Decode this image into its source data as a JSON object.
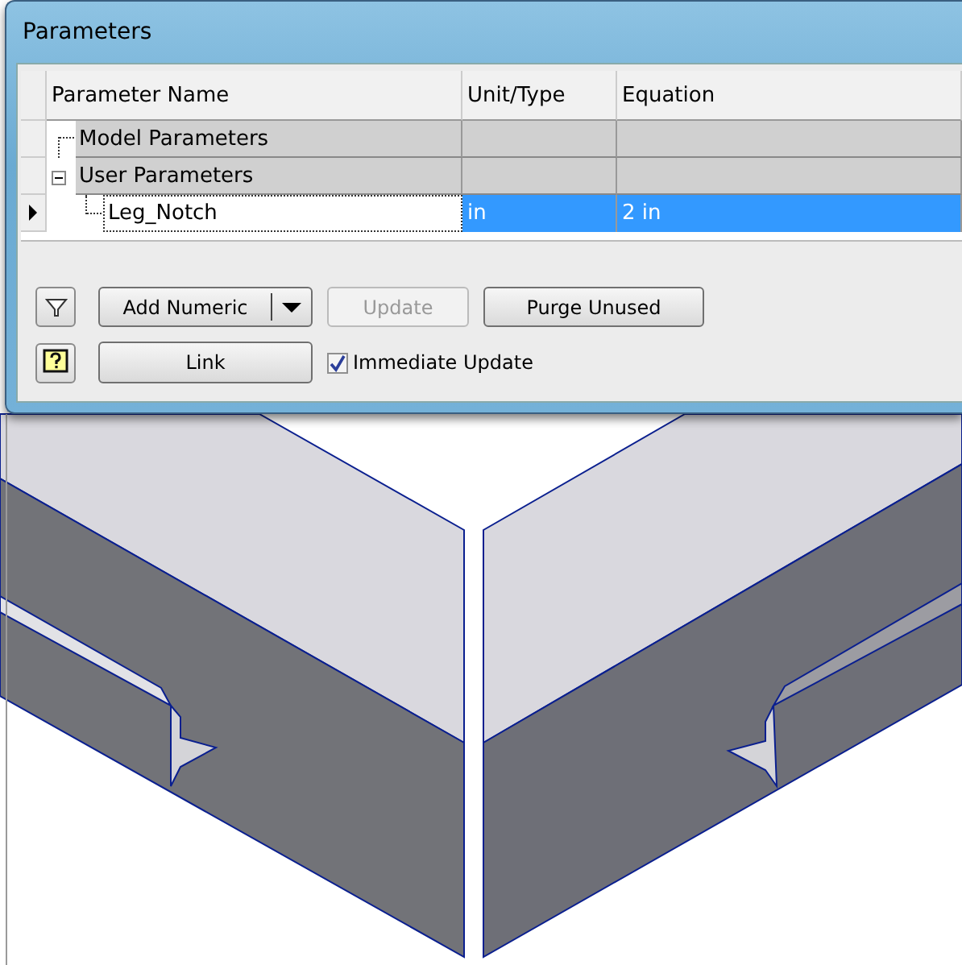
{
  "window": {
    "title": "Parameters"
  },
  "table": {
    "columns": [
      "Parameter Name",
      "Unit/Type",
      "Equation"
    ],
    "rows": [
      {
        "kind": "group",
        "name": "Model Parameters"
      },
      {
        "kind": "group",
        "name": "User Parameters",
        "expanded": true,
        "children": [
          {
            "kind": "param",
            "name": "Leg_Notch",
            "unit": "in",
            "equation": "2 in",
            "selected": true
          }
        ]
      }
    ]
  },
  "toolbar": {
    "buttons": [
      {
        "label": "Add Numeric",
        "kind": "split",
        "disabled": false
      },
      {
        "label": "Update",
        "kind": "plain",
        "disabled": true
      },
      {
        "label": "Purge Unused",
        "kind": "plain",
        "disabled": false
      }
    ],
    "link_button": "Link",
    "checkbox": {
      "label": "Immediate Update",
      "checked": true
    }
  }
}
